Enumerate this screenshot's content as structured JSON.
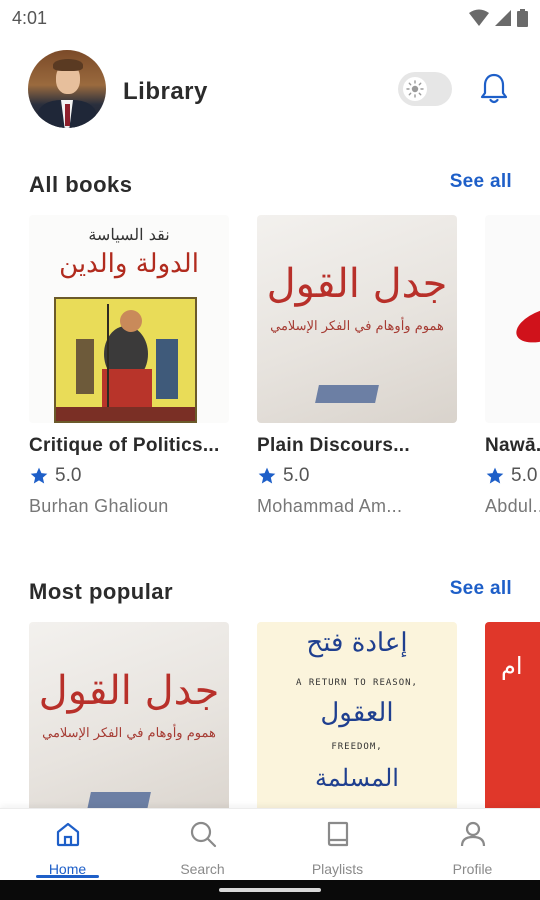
{
  "status_bar": {
    "time": "4:01"
  },
  "header": {
    "title": "Library"
  },
  "sections": {
    "all_books": {
      "title": "All books",
      "see_all": "See all",
      "books": [
        {
          "title": "Critique of Politics...",
          "rating": "5.0",
          "author": "Burhan Ghalioun",
          "cover_lines": [
            "نقد السياسة",
            "الدولة والدين"
          ]
        },
        {
          "title": "Plain Discours...",
          "rating": "5.0",
          "author": "Mohammad Am...",
          "cover_lines": [
            "جدل القول",
            "هموم وأوهام في الفكر الإسلامي"
          ]
        },
        {
          "title": "Nawā...",
          "rating": "5.0",
          "author": "Abdul..."
        }
      ]
    },
    "most_popular": {
      "title": "Most popular",
      "see_all": "See all",
      "books": [
        {
          "cover_lines": [
            "جدل القول",
            "هموم وأوهام في الفكر الإسلامي"
          ]
        },
        {
          "cover_lines": [
            "إعادة فتح",
            "A RETURN TO REASON,",
            "العقول",
            "FREEDOM,",
            "المسلمة"
          ]
        },
        {
          "cover_lines": [
            "ام"
          ]
        }
      ]
    }
  },
  "bottom_nav": [
    {
      "label": "Home",
      "icon": "home-icon",
      "active": true
    },
    {
      "label": "Search",
      "icon": "search-icon",
      "active": false
    },
    {
      "label": "Playlists",
      "icon": "book-icon",
      "active": false
    },
    {
      "label": "Profile",
      "icon": "person-icon",
      "active": false
    }
  ],
  "colors": {
    "accent": "#1e5fc8",
    "star": "#1e5fc8"
  }
}
